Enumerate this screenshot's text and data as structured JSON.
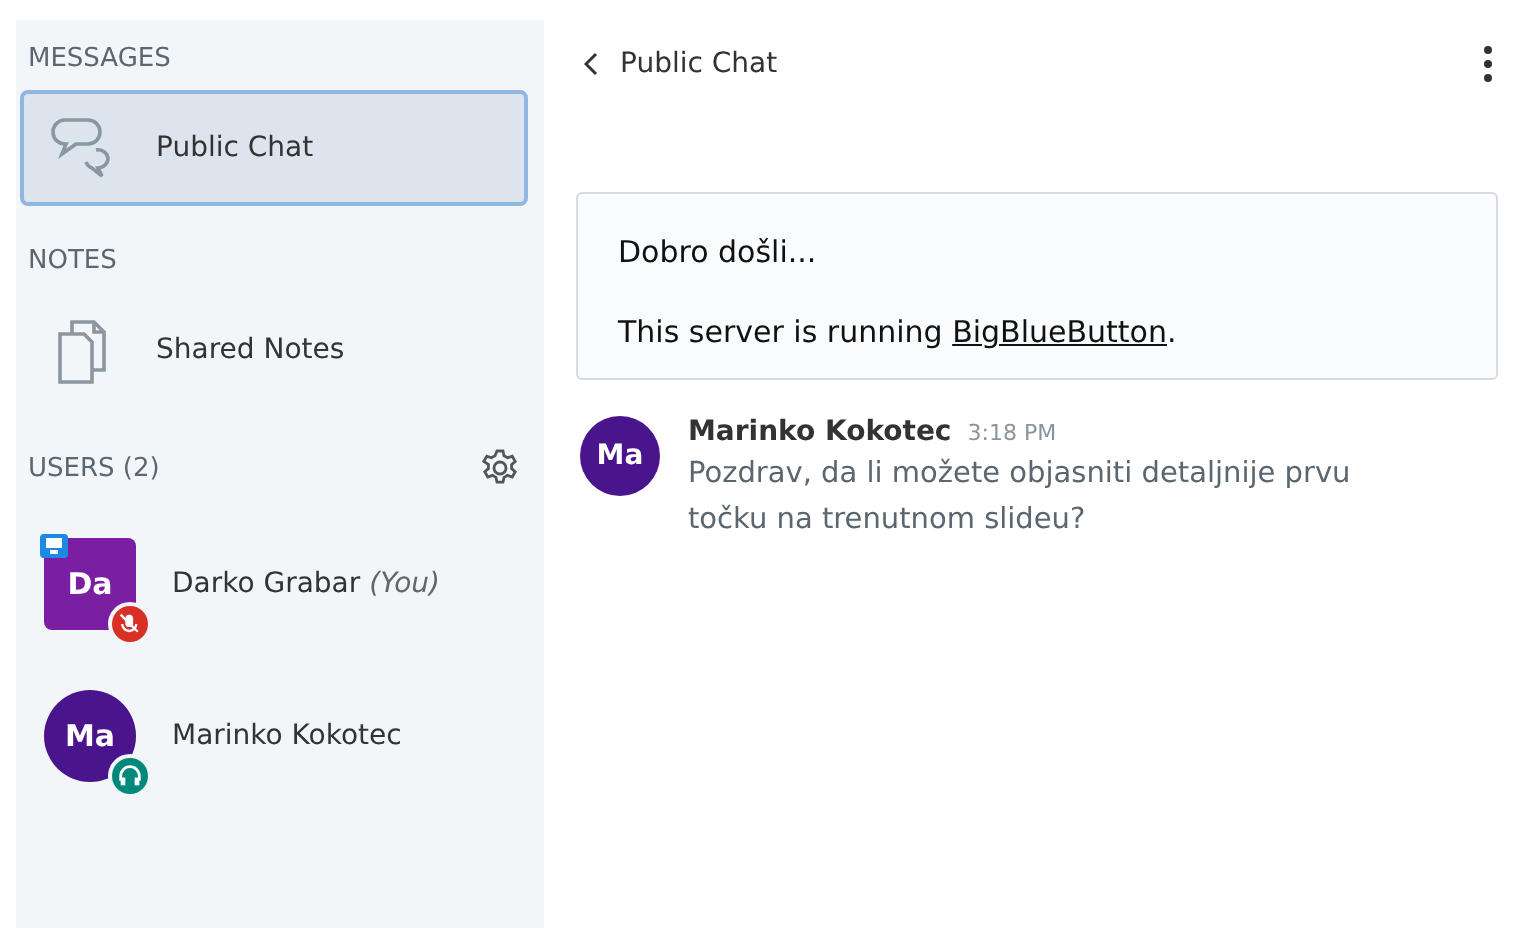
{
  "sidebar": {
    "sections": [
      {
        "title": "MESSAGES",
        "items": [
          {
            "label": "Public Chat",
            "kind": "chat",
            "selected": true
          }
        ]
      },
      {
        "title": "NOTES",
        "items": [
          {
            "label": "Shared Notes",
            "kind": "notes",
            "selected": false
          }
        ]
      }
    ],
    "users": {
      "title": "USERS (2)",
      "list": [
        {
          "initials": "Da",
          "name": "Darko Grabar",
          "suffix": "(You)",
          "kind": "presenter",
          "color": "#7b1fa2",
          "muted": true,
          "listen_only": false
        },
        {
          "initials": "Ma",
          "name": "Marinko Kokotec",
          "kind": "viewer",
          "color": "#4a148c",
          "muted": false,
          "listen_only": true
        }
      ]
    }
  },
  "chat": {
    "title": "Public Chat",
    "welcome": {
      "heading": "Dobro došli...",
      "text_before": "This server is running ",
      "link": "BigBlueButton",
      "text_after": "."
    },
    "messages": [
      {
        "initials": "Ma",
        "color": "#4a148c",
        "author": "Marinko Kokotec",
        "time": "3:18 PM",
        "text": "Pozdrav, da li možete objasniti detaljnije prvu točku na trenutnom slideu?"
      }
    ]
  }
}
